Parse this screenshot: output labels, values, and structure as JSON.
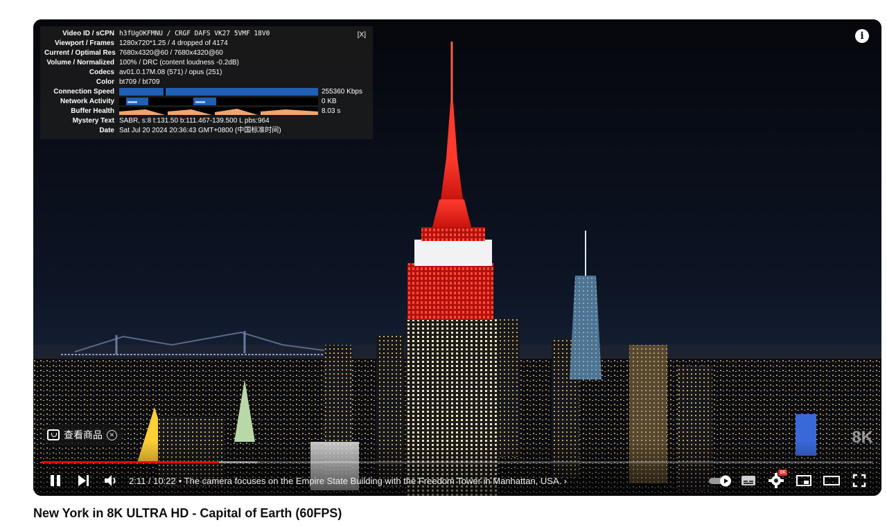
{
  "stats": {
    "close_label": "[X]",
    "rows": [
      {
        "key": "Video ID / sCPN",
        "value": "h3fUgOKFMNU / CRGF DAFS VK27 5VMF 18V0"
      },
      {
        "key": "Viewport / Frames",
        "value": "1280x720*1.25 / 4 dropped of 4174"
      },
      {
        "key": "Current / Optimal Res",
        "value": "7680x4320@60 / 7680x4320@60"
      },
      {
        "key": "Volume / Normalized",
        "value": "100% / DRC (content loudness -0.2dB)"
      },
      {
        "key": "Codecs",
        "value": "av01.0.17M.08 (571) / opus (251)"
      },
      {
        "key": "Color",
        "value": "bt709 / bt709"
      },
      {
        "key": "Connection Speed",
        "value": "255360 Kbps"
      },
      {
        "key": "Network Activity",
        "value": "0 KB"
      },
      {
        "key": "Buffer Health",
        "value": "8.03 s"
      },
      {
        "key": "Mystery Text",
        "value": "SABR, s:8 t:131.50 b:111.467-139.500 L pbs:964"
      },
      {
        "key": "Date",
        "value": "Sat Jul 20 2024 20:36:43 GMT+0800 (中国标准时间)"
      }
    ]
  },
  "overlay": {
    "info_icon": "info-icon",
    "shop_label": "查看商品",
    "badge": "8K"
  },
  "player": {
    "played_fraction": 0.213,
    "loaded_fraction": 0.26,
    "time": "2:11 / 10:22",
    "separator": "•",
    "chapter": "The camera focuses on the Empire State Building with the Freedom Tower in Manhattan, USA.",
    "chapter_arrow": "›",
    "settings_badge": "8K"
  },
  "video": {
    "title": "New York in 8K ULTRA HD - Capital of Earth (60FPS)"
  },
  "colors": {
    "progress_played": "#ff0000",
    "tower_red": "#e0221a",
    "sky": "#0b0f1a"
  }
}
